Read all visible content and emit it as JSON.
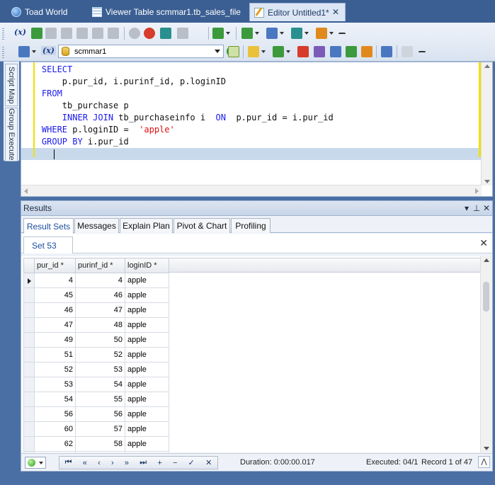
{
  "tabs": [
    {
      "label": "Toad World",
      "icon": "globe-icon"
    },
    {
      "label": "Viewer Table scmmar1.tb_sales_file",
      "icon": "table-icon"
    },
    {
      "label": "Editor Untitled1*",
      "icon": "editor-icon",
      "active": true
    }
  ],
  "toolbar": {
    "variables_label": "(x)",
    "connection": "scmmar1"
  },
  "side_tabs": [
    "Script Map",
    "Group Execute"
  ],
  "editor": {
    "lines": [
      [
        {
          "t": "kw",
          "v": "    SELECT"
        }
      ],
      [
        {
          "t": "txt",
          "v": "        p.pur_id, i.purinf_id, p.loginID"
        }
      ],
      [
        {
          "t": "kw",
          "v": "    FROM"
        }
      ],
      [
        {
          "t": "txt",
          "v": "        tb_purchase p"
        }
      ],
      [
        {
          "t": "kw",
          "v": "        INNER JOIN"
        },
        {
          "t": "txt",
          "v": " tb_purchaseinfo i  "
        },
        {
          "t": "kw",
          "v": "ON"
        },
        {
          "t": "txt",
          "v": "  p.pur_id = i.pur_id"
        }
      ],
      [
        {
          "t": "kw",
          "v": "    WHERE"
        },
        {
          "t": "txt",
          "v": " p.loginID =  "
        },
        {
          "t": "str",
          "v": "'apple'"
        }
      ],
      [
        {
          "t": "kw",
          "v": "    GROUP BY"
        },
        {
          "t": "txt",
          "v": " i.pur_id"
        }
      ],
      [
        {
          "t": "txt",
          "v": ""
        }
      ]
    ]
  },
  "results": {
    "title": "Results",
    "header_buttons": [
      "▾",
      "⊥",
      "✕"
    ],
    "tabs": [
      "Result Sets",
      "Messages",
      "Explain Plan",
      "Pivot & Chart",
      "Profiling"
    ],
    "active_tab": "Result Sets",
    "set_tab": "Set 53",
    "columns": [
      "pur_id *",
      "purinf_id *",
      "loginID *"
    ],
    "rows": [
      [
        "4",
        "4",
        "apple"
      ],
      [
        "45",
        "46",
        "apple"
      ],
      [
        "46",
        "47",
        "apple"
      ],
      [
        "47",
        "48",
        "apple"
      ],
      [
        "49",
        "50",
        "apple"
      ],
      [
        "51",
        "52",
        "apple"
      ],
      [
        "52",
        "53",
        "apple"
      ],
      [
        "53",
        "54",
        "apple"
      ],
      [
        "54",
        "55",
        "apple"
      ],
      [
        "56",
        "56",
        "apple"
      ],
      [
        "60",
        "57",
        "apple"
      ],
      [
        "62",
        "58",
        "apple"
      ],
      [
        "",
        "",
        ""
      ]
    ],
    "nav_buttons": [
      "⏮",
      "«",
      "‹",
      "›",
      "»",
      "⏭",
      "+",
      "−",
      "✓",
      "✕"
    ],
    "duration": "Duration: 0:00:00.017",
    "executed": "Executed: 04/1",
    "record": "Record 1 of 47"
  }
}
